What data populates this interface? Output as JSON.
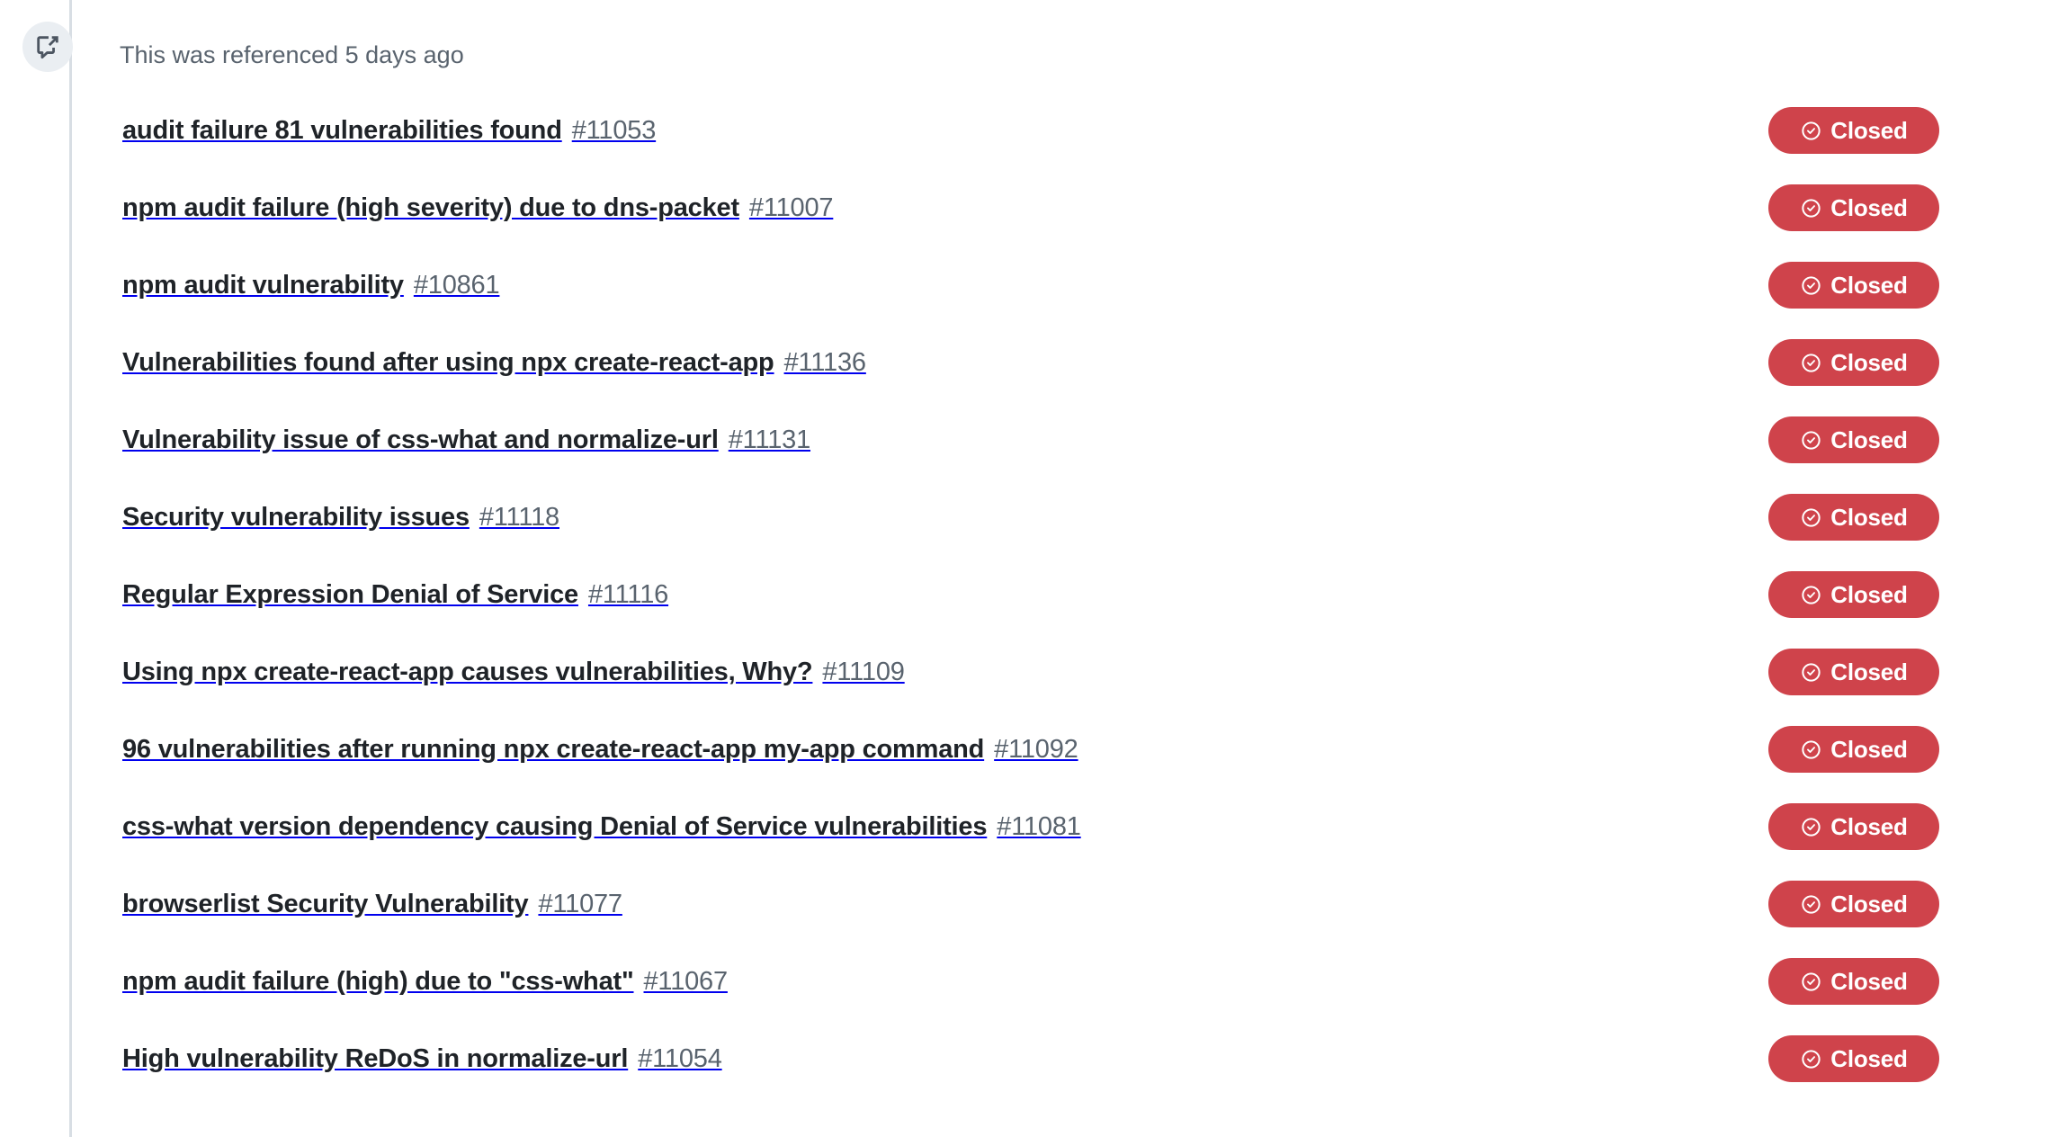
{
  "event": {
    "icon": "cross-reference-icon",
    "text": "This was referenced 5 days ago"
  },
  "colors": {
    "closed_badge": "#cf434b",
    "rail": "#d8dee4",
    "badge_circle": "#eaeef2",
    "title_text": "#1f2328",
    "issue_number_text": "#59636e"
  },
  "status_label": "Closed",
  "status_icon": "check-circle-icon",
  "issues": [
    {
      "title": "audit failure 81 vulnerabilities found",
      "number": "#11053",
      "status": "Closed"
    },
    {
      "title": "npm audit failure (high severity) due to dns-packet",
      "number": "#11007",
      "status": "Closed"
    },
    {
      "title": "npm audit vulnerability",
      "number": "#10861",
      "status": "Closed"
    },
    {
      "title": "Vulnerabilities found after using npx create-react-app",
      "number": "#11136",
      "status": "Closed"
    },
    {
      "title": "Vulnerability issue of css-what and normalize-url",
      "number": "#11131",
      "status": "Closed"
    },
    {
      "title": "Security vulnerability issues",
      "number": "#11118",
      "status": "Closed"
    },
    {
      "title": "Regular Expression Denial of Service",
      "number": "#11116",
      "status": "Closed"
    },
    {
      "title": "Using npx create-react-app causes vulnerabilities, Why?",
      "number": "#11109",
      "status": "Closed"
    },
    {
      "title": "96 vulnerabilities after running npx create-react-app my-app command",
      "number": "#11092",
      "status": "Closed"
    },
    {
      "title": "css-what version dependency causing Denial of Service vulnerabilities",
      "number": "#11081",
      "status": "Closed"
    },
    {
      "title": "browserlist Security Vulnerability",
      "number": "#11077",
      "status": "Closed"
    },
    {
      "title": "npm audit failure (high) due to \"css-what\"",
      "number": "#11067",
      "status": "Closed"
    },
    {
      "title": "High vulnerability ReDoS in normalize-url",
      "number": "#11054",
      "status": "Closed"
    }
  ]
}
